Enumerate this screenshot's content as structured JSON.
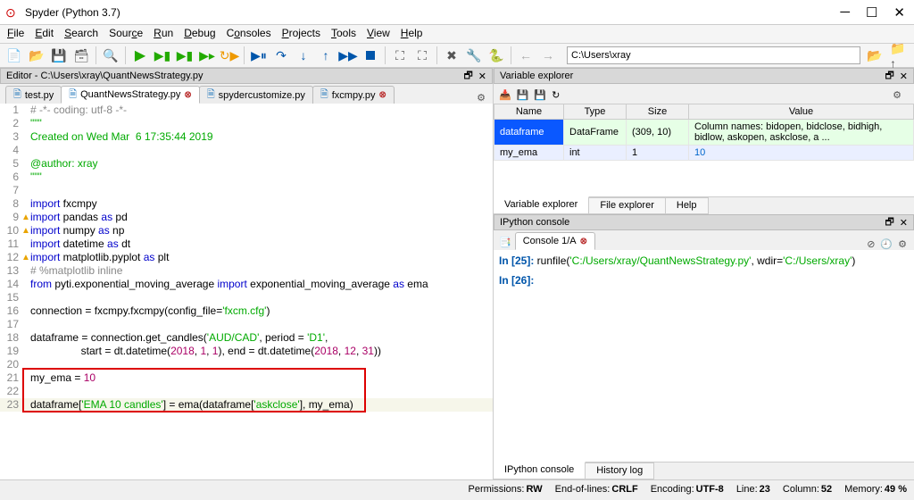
{
  "window": {
    "title": "Spyder (Python 3.7)"
  },
  "menu": {
    "file": "File",
    "edit": "Edit",
    "search": "Search",
    "source": "Source",
    "run": "Run",
    "debug": "Debug",
    "consoles": "Consoles",
    "projects": "Projects",
    "tools": "Tools",
    "view": "View",
    "help": "Help"
  },
  "path": {
    "value": "C:\\Users\\xray"
  },
  "editor": {
    "header": "Editor - C:\\Users\\xray\\QuantNewsStrategy.py",
    "tabs": {
      "test": "test.py",
      "quant": "QuantNewsStrategy.py",
      "custom": "spydercustomize.py",
      "fxcm": "fxcmpy.py"
    }
  },
  "code": {
    "l1": "# -*- coding: utf-8 -*-",
    "l2": "\"\"\"",
    "l3": "Created on Wed Mar  6 17:35:44 2019",
    "l5": "@author: xray",
    "l6": "\"\"\"",
    "l8a": "import",
    "l8b": " fxcmpy",
    "l9a": "import",
    "l9b": " pandas ",
    "l9c": "as",
    "l9d": " pd",
    "l10a": "import",
    "l10b": " numpy ",
    "l10c": "as",
    "l10d": " np",
    "l11a": "import",
    "l11b": " datetime ",
    "l11c": "as",
    "l11d": " dt",
    "l12a": "import",
    "l12b": " matplotlib.pyplot ",
    "l12c": "as",
    "l12d": " plt",
    "l13": "# %matplotlib inline",
    "l14a": "from",
    "l14b": " pyti.exponential_moving_average ",
    "l14c": "import",
    "l14d": " exponential_moving_average ",
    "l14e": "as",
    "l14f": " ema",
    "l16a": "connection = fxcmpy.fxcmpy(config_file=",
    "l16b": "'fxcm.cfg'",
    "l16c": ")",
    "l18a": "dataframe = connection.get_candles(",
    "l18b": "'AUD/CAD'",
    "l18c": ", period = ",
    "l18d": "'D1'",
    "l18e": ",",
    "l19a": "                 start = dt.datetime(",
    "l19b": "2018",
    "l19c": ", ",
    "l19d": "1",
    "l19e": ", ",
    "l19f": "1",
    "l19g": "), end = dt.datetime(",
    "l19h": "2018",
    "l19i": ", ",
    "l19j": "12",
    "l19k": ", ",
    "l19l": "31",
    "l19m": "))",
    "l21a": "my_ema = ",
    "l21b": "10",
    "l23a": "dataframe[",
    "l23b": "'EMA 10 candles'",
    "l23c": "] = ema(dataframe[",
    "l23d": "'askclose'",
    "l23e": "], my_ema)"
  },
  "varex": {
    "header": "Variable explorer",
    "th_name": "Name",
    "th_type": "Type",
    "th_size": "Size",
    "th_value": "Value",
    "r1_name": "dataframe",
    "r1_type": "DataFrame",
    "r1_size": "(309, 10)",
    "r1_val": "Column names: bidopen, bidclose, bidhigh, bidlow, askopen, askclose, a ...",
    "r2_name": "my_ema",
    "r2_type": "int",
    "r2_size": "1",
    "r2_val": "10",
    "tab_var": "Variable explorer",
    "tab_file": "File explorer",
    "tab_help": "Help"
  },
  "ipy": {
    "header": "IPython console",
    "tab": "Console 1/A",
    "in25": "In [25]:",
    "run": " runfile(",
    "arg1": "'C:/Users/xray/QuantNewsStrategy.py'",
    "wdir": ", wdir=",
    "arg2": "'C:/Users/xray'",
    "close": ")",
    "in26": "In [26]:",
    "tab_ipy": "IPython console",
    "tab_hist": "History log"
  },
  "status": {
    "perm_l": "Permissions:",
    "perm_v": "RW",
    "eol_l": "End-of-lines:",
    "eol_v": "CRLF",
    "enc_l": "Encoding:",
    "enc_v": "UTF-8",
    "line_l": "Line:",
    "line_v": "23",
    "col_l": "Column:",
    "col_v": "52",
    "mem_l": "Memory:",
    "mem_v": "49 %"
  }
}
